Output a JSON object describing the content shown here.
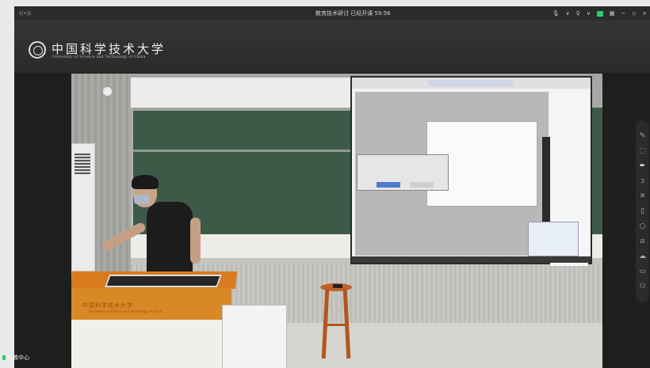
{
  "titlebar": {
    "title": "教育技术研讨  已经开课 59:56",
    "left_icon": "broadcast-icon",
    "mic_icon": "microphone-icon",
    "user_icon": "user-icon",
    "chev": "∨",
    "minimize": "−",
    "restore": "▫",
    "close": "×"
  },
  "banner": {
    "logo_cn": "中国科学技术大学",
    "logo_en": "University of Science and Technology of China"
  },
  "podium": {
    "logo_cn": "中国科学技术大学",
    "logo_en": "University of Science and Technology of China"
  },
  "rail": {
    "icons": [
      "pencil-icon",
      "select-icon",
      "pen-icon",
      "lasso-icon",
      "close-icon",
      "trash-icon",
      "circle-icon",
      "edit-icon",
      "cloud-icon",
      "briefcase-icon",
      "users-icon"
    ]
  },
  "footer": {
    "label": "哥教中心"
  },
  "colors": {
    "accent_green": "#2ecc71",
    "window_bg": "#1e1e1e"
  }
}
